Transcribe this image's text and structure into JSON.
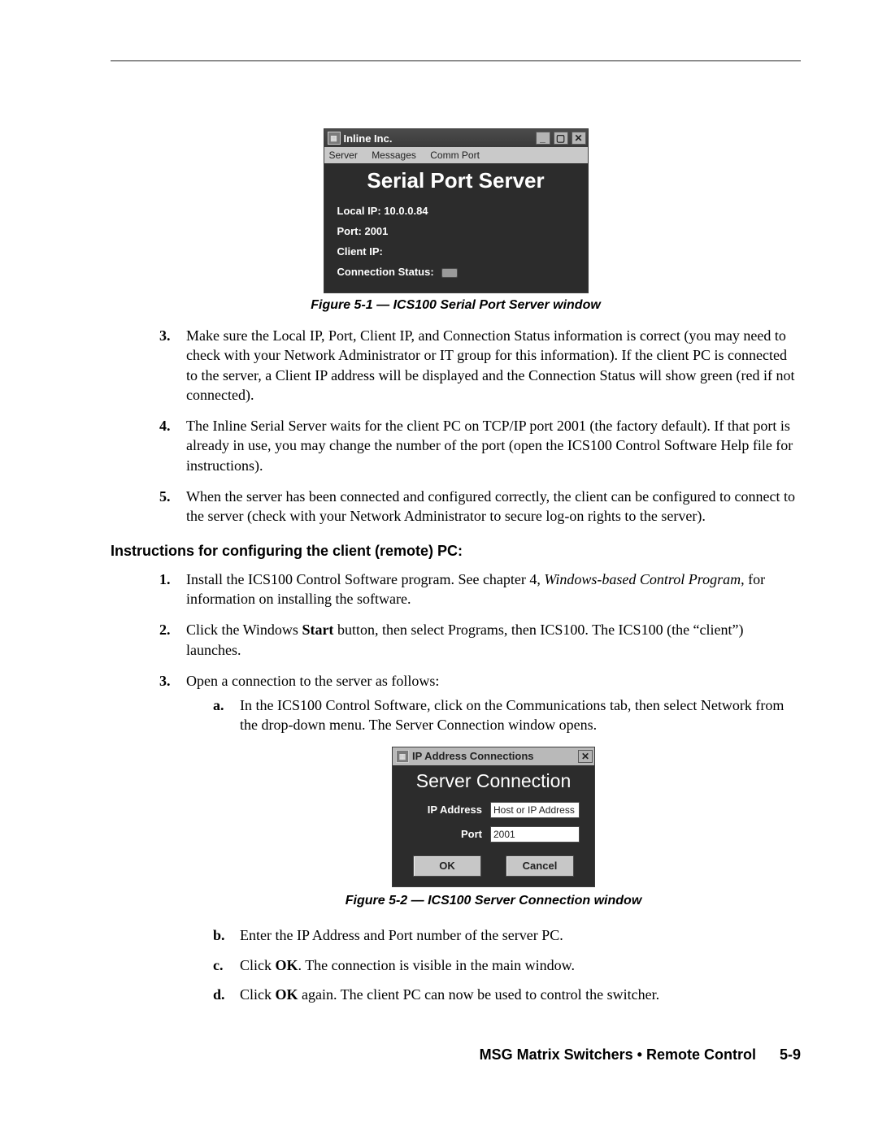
{
  "win1": {
    "title": "Inline Inc.",
    "menu": {
      "server": "Server",
      "messages": "Messages",
      "commport": "Comm Port"
    },
    "banner": "Serial Port Server",
    "local_ip_label": "Local IP:",
    "local_ip_value": "10.0.0.84",
    "port_label": "Port:",
    "port_value": "2001",
    "client_ip_label": "Client IP:",
    "client_ip_value": "",
    "conn_status_label": "Connection Status:"
  },
  "captions": {
    "fig1": "Figure 5-1 — ICS100 Serial Port Server window",
    "fig2": "Figure 5-2 — ICS100 Server Connection window"
  },
  "steps_a": {
    "s3_num": "3.",
    "s3": "Make sure the Local IP, Port, Client IP, and Connection Status information is correct (you may need to check with your Network Administrator or IT group for this information).  If the client PC is connected to the server, a Client IP address will be displayed and the Connection Status will show green (red if not connected).",
    "s4_num": "4.",
    "s4": "The Inline Serial Server waits for the client PC on TCP/IP port 2001 (the factory default). If that port is already in use, you may change the number of the port (open the ICS100 Control Software Help file for instructions).",
    "s5_num": "5.",
    "s5": "When the server has been connected and configured correctly, the client can be configured to connect to the server (check with your Network Administrator to secure log-on rights to the server)."
  },
  "heading_client": "Instructions for configuring the client (remote) PC:",
  "steps_b": {
    "s1_num": "1.",
    "s1_pre": "Install the ICS100 Control Software program.  See chapter 4, ",
    "s1_ital": "Windows-based Control Program",
    "s1_post": ", for information on installing the software.",
    "s2_num": "2.",
    "s2_pre": "Click the Windows ",
    "s2_bold": "Start",
    "s2_post": " button, then select Programs, then ICS100. The ICS100 (the “client”) launches.",
    "s3_num": "3.",
    "s3": "Open a connection to the server as follows:",
    "a_num": "a.",
    "a": "In the ICS100 Control Software, click on the Communications tab, then select Network from the drop-down menu. The Server Connection window opens."
  },
  "win2": {
    "title": "IP Address Connections",
    "banner": "Server Connection",
    "ip_label": "IP Address",
    "ip_value": "Host or IP Address",
    "port_label": "Port",
    "port_value": "2001",
    "ok": "OK",
    "cancel": "Cancel"
  },
  "steps_c": {
    "b_num": "b.",
    "b": "Enter the IP Address and Port number of the server PC.",
    "c_num": "c.",
    "c_pre": "Click ",
    "c_bold": "OK",
    "c_post": ". The connection is visible in the main window.",
    "d_num": "d.",
    "d_pre": "Click ",
    "d_bold": "OK",
    "d_post": " again. The client PC can now be used to control the switcher."
  },
  "footer": {
    "title": "MSG Matrix Switchers • Remote Control",
    "page": "5-9"
  }
}
